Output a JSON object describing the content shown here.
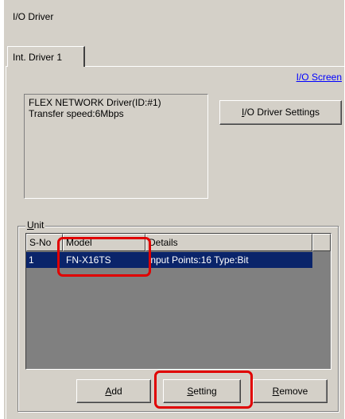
{
  "window": {
    "title": "I/O Driver"
  },
  "tabs": [
    {
      "label": "Int. Driver 1"
    }
  ],
  "io_screen_link": "I/O Screen",
  "driver_info": {
    "line1": "FLEX NETWORK Driver(ID:#1)",
    "line2": "Transfer speed:6Mbps"
  },
  "io_driver_settings_button": {
    "hotkey": "I",
    "rest": "/O Driver Settings"
  },
  "unit_group": {
    "hotkey": "U",
    "rest": "nit"
  },
  "unit_table": {
    "columns": {
      "sno": "S-No",
      "model": "Model",
      "details": "Details"
    },
    "rows": [
      {
        "sno": "1",
        "model": "FN-X16TS",
        "details": "Input Points:16 Type:Bit"
      }
    ]
  },
  "buttons": {
    "add": {
      "hotkey": "A",
      "rest": "dd"
    },
    "setting": {
      "hotkey": "S",
      "rest": "etting"
    },
    "remove": {
      "hotkey": "R",
      "rest": "emove"
    }
  },
  "colors": {
    "dialog_bg": "#d4d0c8",
    "selection_bg": "#0a246a",
    "highlight": "#e00000",
    "link": "#0000ff"
  }
}
